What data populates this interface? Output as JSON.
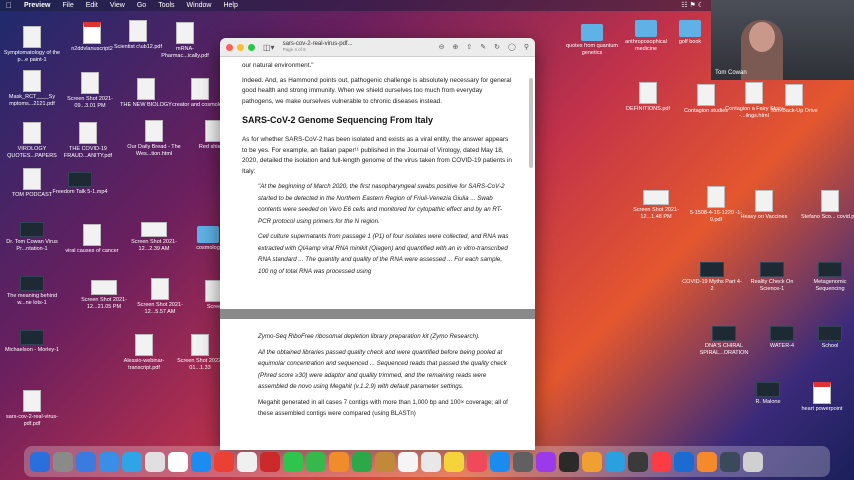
{
  "menubar": {
    "items": [
      "Preview",
      "File",
      "Edit",
      "View",
      "Go",
      "Tools",
      "Window",
      "Help"
    ],
    "clock": ""
  },
  "desktop_icons_left": [
    {
      "label": "Symptomatology of the p...e paint-1",
      "type": "doc"
    },
    {
      "label": "n2ddvlanuscript2",
      "type": "red"
    },
    {
      "label": "Scientist c\\ub12.pdf",
      "type": "doc"
    },
    {
      "label": "mRNA-Pharmac...ically.pdf",
      "type": "doc"
    },
    {
      "label": "Mask_RCT____Sy mptoms...2121.pdf",
      "type": "doc"
    },
    {
      "label": "Screen Shot 2021-09...3.01 PM",
      "type": "doc"
    },
    {
      "label": "THE NEW BIOLOGY",
      "type": "doc"
    },
    {
      "label": "creator and cosmology",
      "type": "doc"
    },
    {
      "label": "VIROLOGY QUOTES...PAPERS",
      "type": "doc"
    },
    {
      "label": "THE COVID-19 FRAUD...ANITY.pdf",
      "type": "doc"
    },
    {
      "label": "Our Daily Bread - The Wes...tion.html",
      "type": "doc"
    },
    {
      "label": "Red shield c",
      "type": "doc"
    },
    {
      "label": "TOM PODCAST",
      "type": "doc"
    },
    {
      "label": "Freedom Talk 5-1.mp4",
      "type": "dark"
    },
    {
      "label": "Dr. Tom Cowan Virus Pr...ntation-1",
      "type": "dark"
    },
    {
      "label": "viral causes of cancer",
      "type": "doc"
    },
    {
      "label": "Screen Shot 2021-12...2.39 AM",
      "type": "wide"
    },
    {
      "label": "cosmolog",
      "type": "folder"
    },
    {
      "label": "The meaning behind w...ne lots-1",
      "type": "dark"
    },
    {
      "label": "Screen Shot 2021-12...21.05 PM",
      "type": "wide"
    },
    {
      "label": "Screen Shot 2021-12...5.57 AM",
      "type": "doc"
    },
    {
      "label": "Scree",
      "type": "doc"
    },
    {
      "label": "Michaelson - Morley-1",
      "type": "dark"
    },
    {
      "label": "Alessio-webinar-transcript.pdf",
      "type": "doc"
    },
    {
      "label": "Screen Shot 2022-01...1.33",
      "type": "doc"
    },
    {
      "label": "sars-cov-2-real-virus-pdf.pdf",
      "type": "doc"
    }
  ],
  "desktop_icons_right": [
    {
      "label": "quotes from quantum genetics",
      "type": "folder"
    },
    {
      "label": "anthroposophical medicine",
      "type": "folder"
    },
    {
      "label": "golf book",
      "type": "folder"
    },
    {
      "label": "DEFINITIONS.pdf",
      "type": "doc"
    },
    {
      "label": "Contagion studies",
      "type": "doc"
    },
    {
      "label": "Contagion a Fairy Story -...ilngs.html",
      "type": "doc"
    },
    {
      "label": "Tom Back-Up Drive",
      "type": "doc"
    },
    {
      "label": "Screen Shot 2021-12...1.48 PM",
      "type": "wide"
    },
    {
      "label": "5-1508-4-16-1220 -1-9.pdf",
      "type": "doc"
    },
    {
      "label": "Heavy on Vaccines",
      "type": "doc"
    },
    {
      "label": "Stefano Sco... covid.ppt",
      "type": "doc"
    },
    {
      "label": "COVID-19 Myths Part 4-2",
      "type": "dark"
    },
    {
      "label": "Reality Check On Science-1",
      "type": "dark"
    },
    {
      "label": "Metagenomic Sequencing",
      "type": "dark"
    },
    {
      "label": "DNA'S CHIRAL SPIRAL...ORATION",
      "type": "dark"
    },
    {
      "label": "WATER-4",
      "type": "dark"
    },
    {
      "label": "School",
      "type": "dark"
    },
    {
      "label": "R. Malone",
      "type": "dark"
    },
    {
      "label": "heart powerpoint",
      "type": "red"
    }
  ],
  "window": {
    "title": "sars-cov-2-real-virus-pdf...",
    "subtitle": "Page 4 of 8"
  },
  "page1": {
    "para0": "our natural environment.\"",
    "para1": "Indeed. And, as Hammond points out, pathogenic challenge is absolutely necessary for general good health and strong immunity. When we shield ourselves too much from everyday pathogens, we make ourselves vulnerable to chronic diseases instead.",
    "heading": "SARS-CoV-2 Genome Sequencing From Italy",
    "para2": "As for whether SARS-CoV-2 has been isolated and exists as a viral entity, the answer appears to be yes. For example, an Italian paper¹¹ published in the Journal of Virology, dated May 18, 2020, detailed the isolation and full-length genome of the virus taken from COVID-19 patients in Italy:",
    "quote1": "\"At the beginning of March 2020, the first nasopharyngeal swabs positive for SARS-CoV-2 started to be detected in the Northern Eastern Region of Friuli-Venezia Giulia ... Swab contents were seeded on Vero E6 cells and monitored for cytopathic effect and by an RT-PCR protocol using primers for the N region.",
    "quote2": "Cell culture supernatants from passage 1 (P1) of four isolates were collected, and RNA was extracted with QIAamp viral RNA minikit (Qiagen) and quantified with an in vitro-transcribed RNA standard ... The quantity and quality of the RNA were assessed ... For each sample, 100 ng of total RNA was processed using"
  },
  "page2": {
    "quote1": "Zymo-Seq RiboFree ribosomal depletion library preparation kit (Zymo Research).",
    "quote2": "All the obtained libraries passed quality check and were quantified before being pooled at equimolar concentration and sequenced ... Sequenced reads that passed the quality check (Phred score ≥30) were adaptor and quality trimmed, and the remaining reads were assembled de novo using Megahit (v.1.2.9) with default parameter settings.",
    "quote3": "Megahit generated in all cases 7 contigs with more than 1,000 bp and 100× coverage; all of these assembled contigs were compared (using BLASTn)"
  },
  "webcam": {
    "name": "Tom Cowan"
  },
  "dock": {
    "colors": [
      "#2a6fdb",
      "#8a8a8a",
      "#3b7be0",
      "#3a8ee6",
      "#2fa4e7",
      "#e0e0e0",
      "#ffffff",
      "#1c8cf0",
      "#e94235",
      "#f0f0f0",
      "#cc2a2a",
      "#2fc44c",
      "#36b84a",
      "#f08c2a",
      "#2ca84a",
      "#c08a3a",
      "#f5f5f5",
      "#e8e8e8",
      "#f5d33a",
      "#f04a5a",
      "#1a8cf0",
      "#606060",
      "#9a3ae8",
      "#2a2a2a",
      "#f0a030",
      "#2aa0e0",
      "#3a3a3a",
      "#fc3c44",
      "#1a6cd0",
      "#f58a2a",
      "#3a4a5a",
      "#d0d0d0"
    ]
  }
}
